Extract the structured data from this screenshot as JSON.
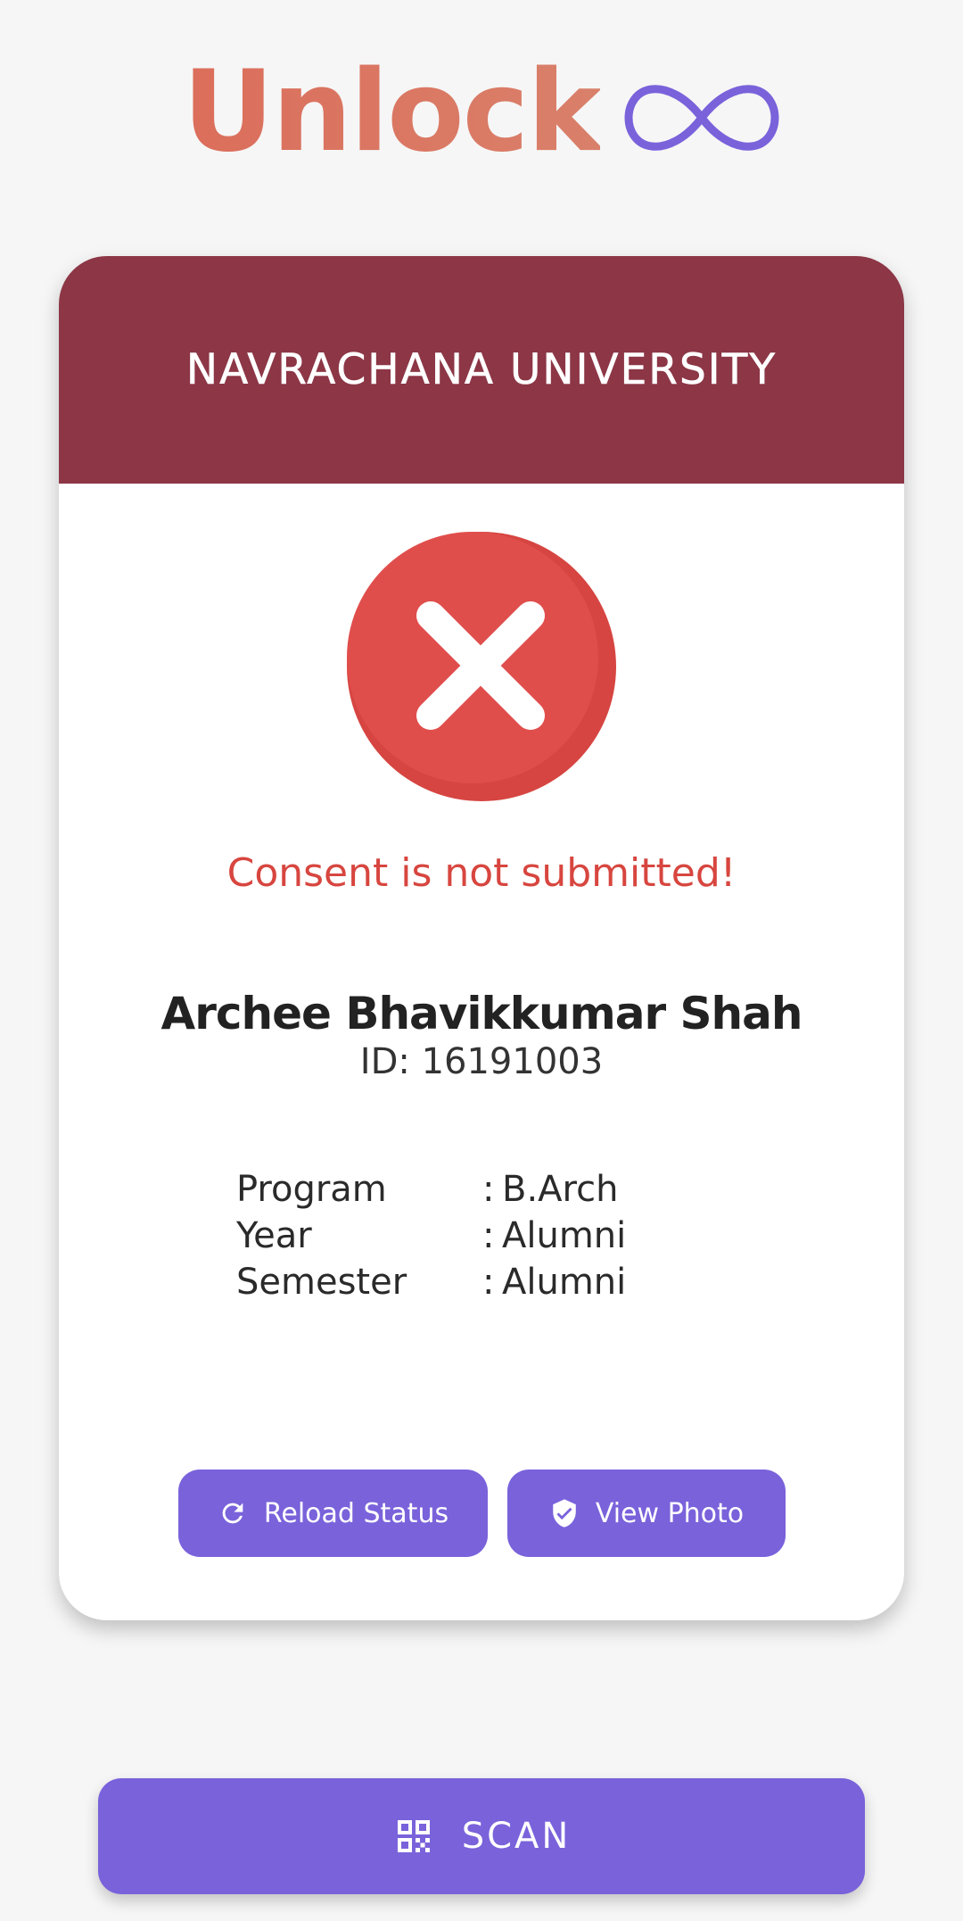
{
  "app": {
    "logo_text": "Unlock",
    "logo_icon": "infinity-icon",
    "colors": {
      "logo_orange": "#db6e5b",
      "accent_purple": "#7a62db",
      "header_maroon": "#8c3646",
      "error_red": "#d7463f"
    }
  },
  "card": {
    "university": "NAVRACHANA UNIVERSITY",
    "status_icon": "error-x-icon",
    "status_message": "Consent is not submitted!",
    "student": {
      "name": "Archee Bhavikkumar Shah",
      "id_line": "ID: 16191003"
    },
    "details": [
      {
        "label": "Program",
        "value": "B.Arch"
      },
      {
        "label": "Year",
        "value": "Alumni"
      },
      {
        "label": "Semester",
        "value": "Alumni"
      }
    ],
    "detail_separator": ":",
    "buttons": {
      "reload_label": "Reload Status",
      "reload_icon": "refresh-icon",
      "photo_label": "View Photo",
      "photo_icon": "shield-check-icon"
    }
  },
  "scan": {
    "label": "SCAN",
    "icon": "qr-code-icon"
  }
}
